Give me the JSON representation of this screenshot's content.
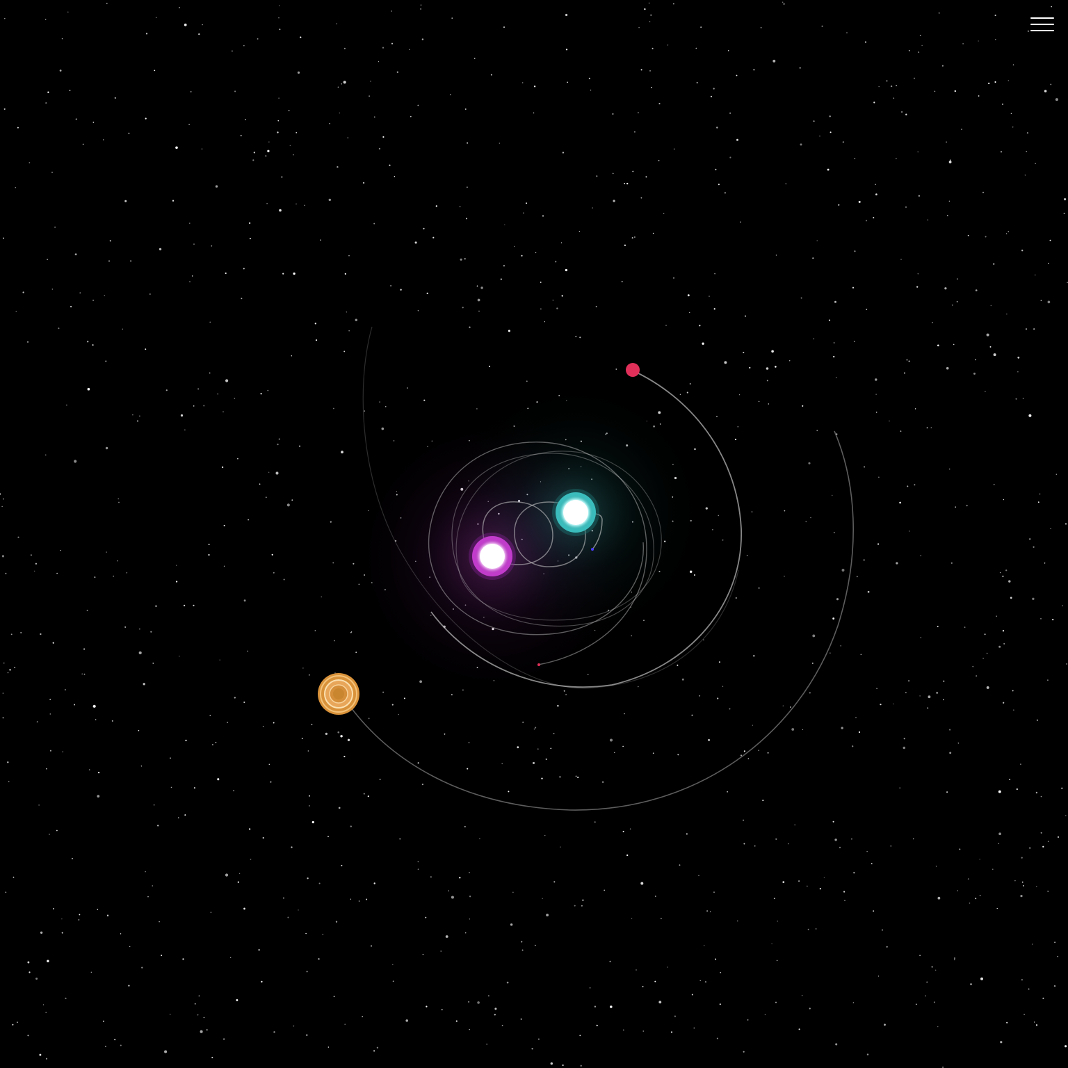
{
  "colors": {
    "background": "#000000",
    "star_field": "#ffffff",
    "orbit_trail": "#cfcfcf",
    "sun_primary_glow": "#d14bd6",
    "sun_secondary_glow": "#4fd6d6",
    "red_planet": "#e0305a",
    "ringed_planet": "#d9923a"
  },
  "icons": {
    "menu": "hamburger-menu-icon"
  },
  "bodies": [
    {
      "name": "magenta-sun",
      "kind": "star",
      "color": "#d14bd6"
    },
    {
      "name": "cyan-sun",
      "kind": "star",
      "color": "#4fd6d6"
    },
    {
      "name": "red-planet",
      "kind": "planet",
      "color": "#e0305a"
    },
    {
      "name": "ringed-planet",
      "kind": "planet",
      "color": "#d9923a"
    }
  ]
}
